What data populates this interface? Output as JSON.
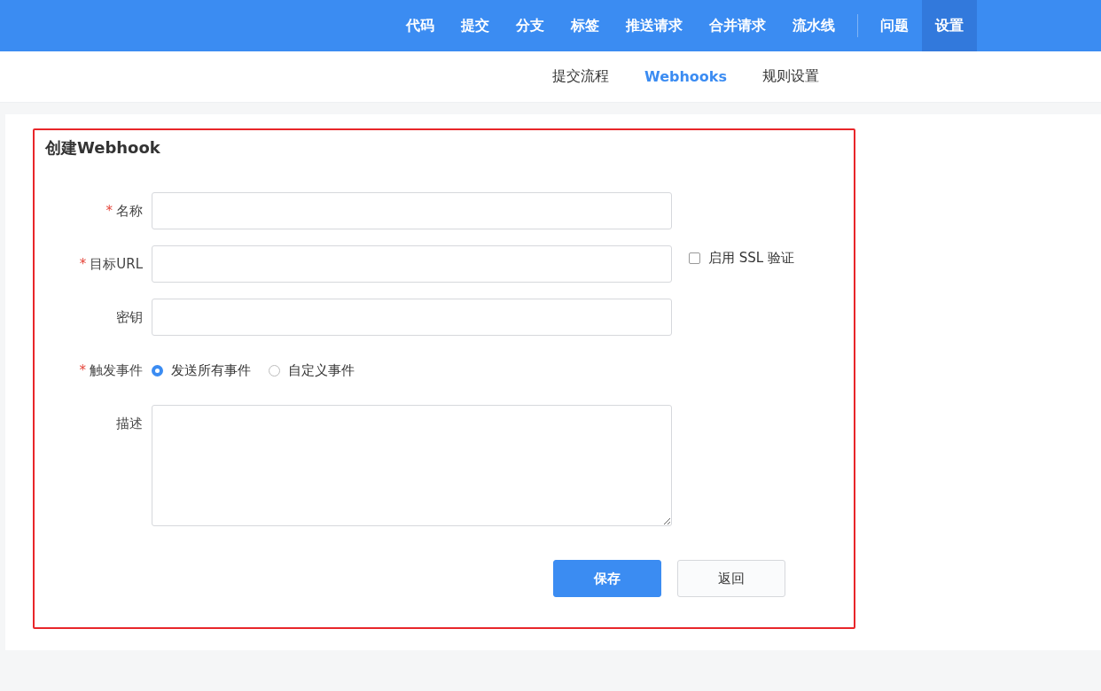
{
  "top_nav": {
    "primary": [
      {
        "label": "代码",
        "selected": false
      },
      {
        "label": "提交",
        "selected": false
      },
      {
        "label": "分支",
        "selected": false
      },
      {
        "label": "标签",
        "selected": false
      },
      {
        "label": "推送请求",
        "selected": false
      },
      {
        "label": "合并请求",
        "selected": false
      },
      {
        "label": "流水线",
        "selected": false
      }
    ],
    "secondary": [
      {
        "label": "问题",
        "selected": false
      },
      {
        "label": "设置",
        "selected": true
      }
    ]
  },
  "sub_nav": [
    {
      "label": "提交流程",
      "selected": false
    },
    {
      "label": "Webhooks",
      "selected": true
    },
    {
      "label": "规则设置",
      "selected": false
    }
  ],
  "form": {
    "title": "创建Webhook",
    "fields": [
      {
        "kind": "input",
        "label": "名称",
        "required_mark": "*"
      },
      {
        "kind": "input",
        "label": "目标URL",
        "required_mark": "*",
        "checkbox": {
          "label": "启用 SSL 验证",
          "checked": false
        }
      },
      {
        "kind": "input",
        "label": "密钥"
      },
      {
        "kind": "radio",
        "label": "触发事件",
        "required_mark": "*",
        "options": [
          {
            "label": "发送所有事件",
            "selected": true
          },
          {
            "label": "自定义事件",
            "selected": false
          }
        ]
      },
      {
        "kind": "textarea",
        "label": "描述"
      }
    ],
    "buttons": [
      {
        "label": "保存",
        "kind": "primary"
      },
      {
        "label": "返回",
        "kind": "default"
      }
    ]
  }
}
